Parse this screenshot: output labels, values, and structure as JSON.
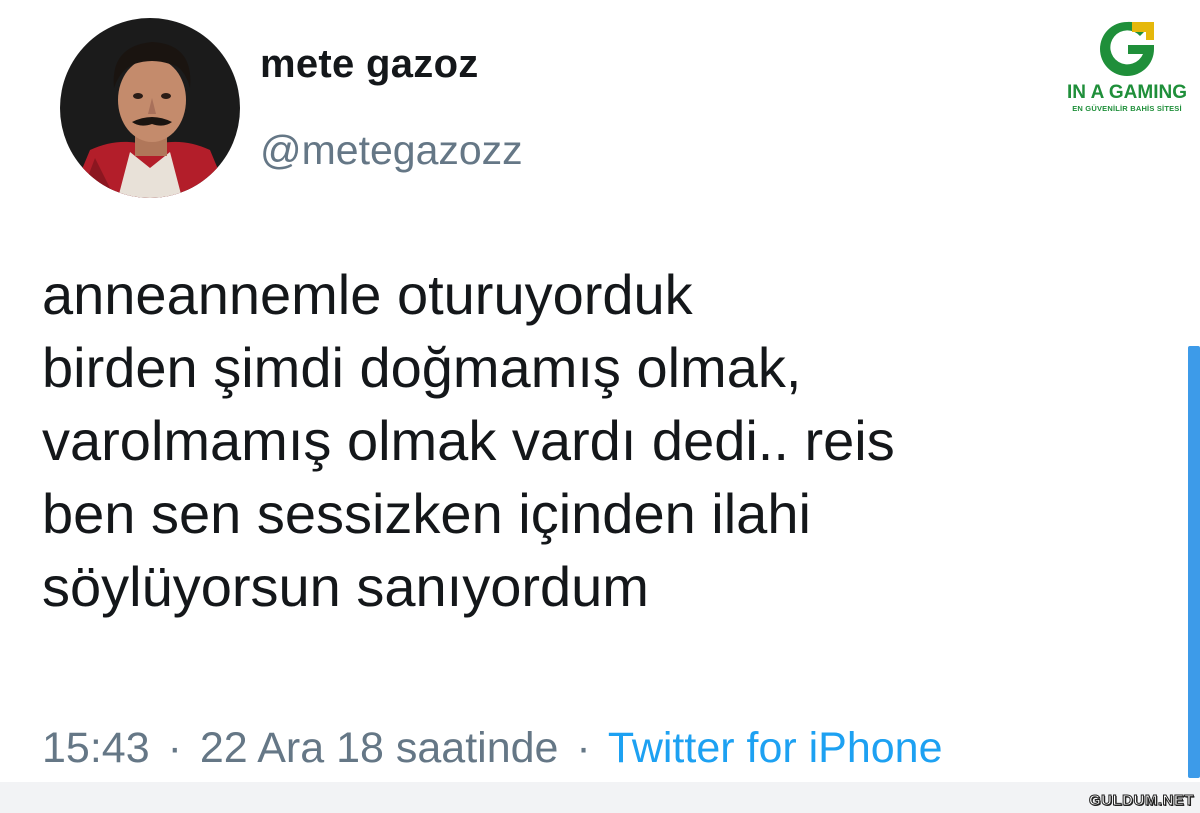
{
  "tweet": {
    "author": {
      "display_name": "mete gazoz",
      "handle": "@metegazozz",
      "avatar_icon": "profile-photo"
    },
    "text_lines": [
      "anneannemle oturuyorduk",
      "birden şimdi doğmamış olmak,",
      "varolmamış olmak vardı dedi.. reis",
      "ben sen sessizken içinden ilahi",
      "söylüyorsun sanıyordum"
    ],
    "meta": {
      "time": "15:43",
      "separator": "·",
      "date": "22 Ara 18 saatinde",
      "source": "Twitter for iPhone"
    }
  },
  "brand": {
    "name": "IN A GAMING",
    "tagline": "EN GÜVENİLİR BAHİS SİTESİ",
    "colors": {
      "green": "#1f8f3a",
      "gold": "#e5b80b"
    }
  },
  "watermark": {
    "text": "GULDUM.NET"
  },
  "colors": {
    "text": "#14171a",
    "secondary": "#657786",
    "link": "#1da1f2",
    "scroll": "#3d9be9"
  }
}
